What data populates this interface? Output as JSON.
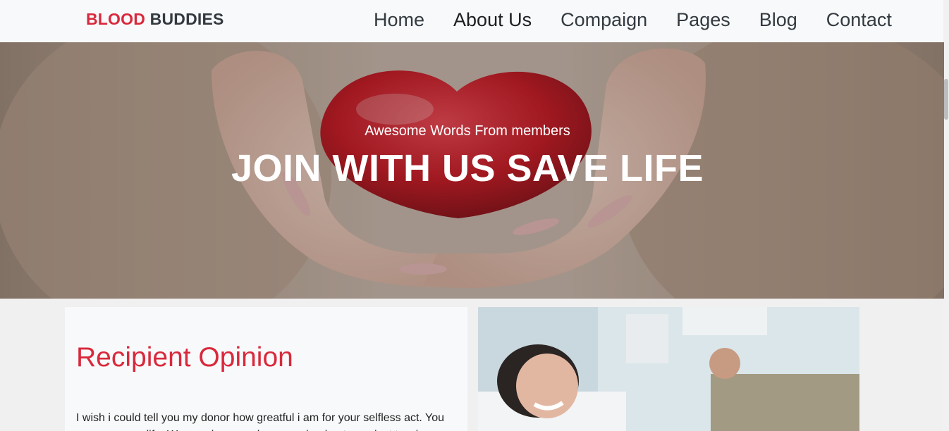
{
  "brand": {
    "part1": "BLOOD",
    "part2": "BUDDIES"
  },
  "nav": {
    "items": [
      {
        "label": "Home"
      },
      {
        "label": "About Us"
      },
      {
        "label": "Compaign"
      },
      {
        "label": "Pages"
      },
      {
        "label": "Blog"
      },
      {
        "label": "Contact"
      }
    ]
  },
  "hero": {
    "subtitle": "Awesome Words From members",
    "title": "JOIN WITH US SAVE LIFE"
  },
  "card": {
    "title": "Recipient Opinion",
    "text": "I wish i could tell you my donor how greatful i am for your selfless act. You gave me new life. We may be coworkers or schoolmates or just two in same"
  },
  "colors": {
    "accent": "#d9293c",
    "dark": "#333a40",
    "navbar_bg": "#f8f9fa"
  }
}
